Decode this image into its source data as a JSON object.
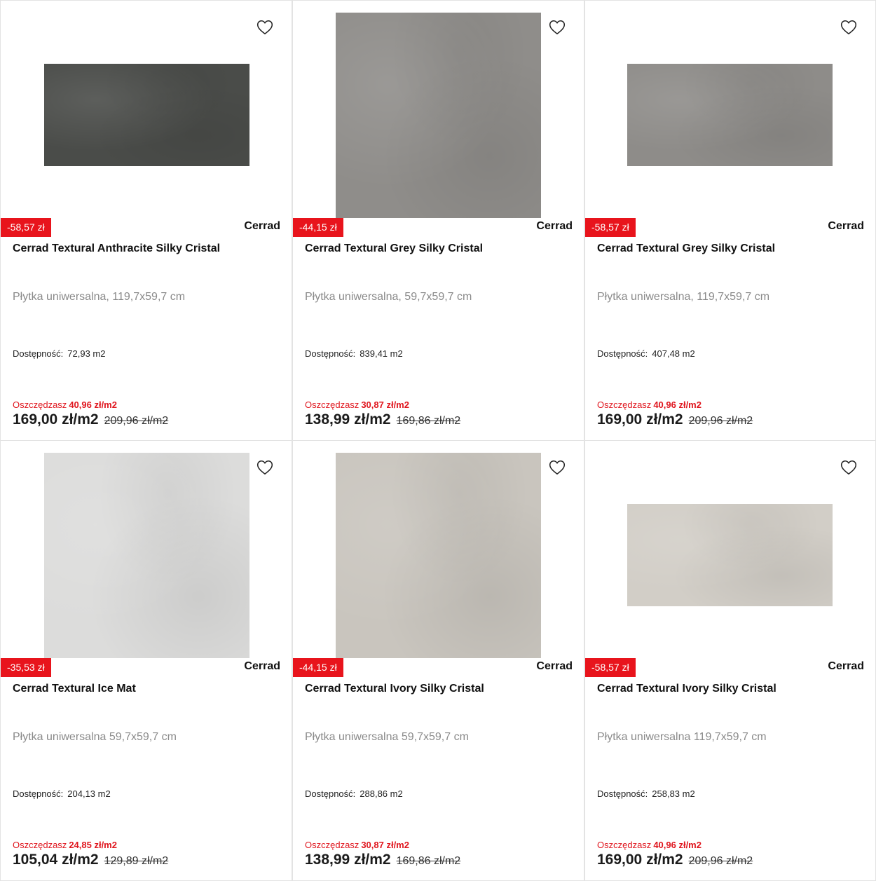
{
  "products": [
    {
      "discount_badge": "-58,57 zł",
      "brand": "Cerrad",
      "title": "Cerrad Textural Anthracite Silky Cristal",
      "description": "Płytka uniwersalna, 119,7x59,7 cm",
      "availability_label": "Dostępność:",
      "availability_value": "72,93 m2",
      "savings_label": "Oszczędzasz",
      "savings_amount": "40,96 zł/m2",
      "price": "169,00 zł/m2",
      "old_price": "209,96 zł/m2",
      "tile_color": "#4a4c49"
    },
    {
      "discount_badge": "-44,15 zł",
      "brand": "Cerrad",
      "title": "Cerrad Textural Grey Silky Cristal",
      "description": "Płytka uniwersalna, 59,7x59,7 cm",
      "availability_label": "Dostępność:",
      "availability_value": "839,41 m2",
      "savings_label": "Oszczędzasz",
      "savings_amount": "30,87 zł/m2",
      "price": "138,99 zł/m2",
      "old_price": "169,86 zł/m2",
      "tile_color": "#8f8d8a"
    },
    {
      "discount_badge": "-58,57 zł",
      "brand": "Cerrad",
      "title": "Cerrad Textural Grey Silky Cristal",
      "description": "Płytka uniwersalna, 119,7x59,7 cm",
      "availability_label": "Dostępność:",
      "availability_value": "407,48 m2",
      "savings_label": "Oszczędzasz",
      "savings_amount": "40,96 zł/m2",
      "price": "169,00 zł/m2",
      "old_price": "209,96 zł/m2",
      "tile_color": "#8e8c89"
    },
    {
      "discount_badge": "-35,53 zł",
      "brand": "Cerrad",
      "title": "Cerrad Textural Ice Mat",
      "description": "Płytka uniwersalna 59,7x59,7 cm",
      "availability_label": "Dostępność:",
      "availability_value": "204,13 m2",
      "savings_label": "Oszczędzasz",
      "savings_amount": "24,85 zł/m2",
      "price": "105,04 zł/m2",
      "old_price": "129,89 zł/m2",
      "tile_color": "#dcdcdb"
    },
    {
      "discount_badge": "-44,15 zł",
      "brand": "Cerrad",
      "title": "Cerrad Textural Ivory Silky Cristal",
      "description": "Płytka uniwersalna 59,7x59,7 cm",
      "availability_label": "Dostępność:",
      "availability_value": "288,86 m2",
      "savings_label": "Oszczędzasz",
      "savings_amount": "30,87 zł/m2",
      "price": "138,99 zł/m2",
      "old_price": "169,86 zł/m2",
      "tile_color": "#c9c5be"
    },
    {
      "discount_badge": "-58,57 zł",
      "brand": "Cerrad",
      "title": "Cerrad Textural Ivory Silky Cristal",
      "description": "Płytka uniwersalna 119,7x59,7 cm",
      "availability_label": "Dostępność:",
      "availability_value": "258,83 m2",
      "savings_label": "Oszczędzasz",
      "savings_amount": "40,96 zł/m2",
      "price": "169,00 zł/m2",
      "old_price": "209,96 zł/m2",
      "tile_color": "#d2cec7"
    }
  ],
  "colors": {
    "accent_red": "#e8141c",
    "border": "#e3e3e3"
  },
  "icons": {
    "favorite": "heart-outline-icon"
  }
}
